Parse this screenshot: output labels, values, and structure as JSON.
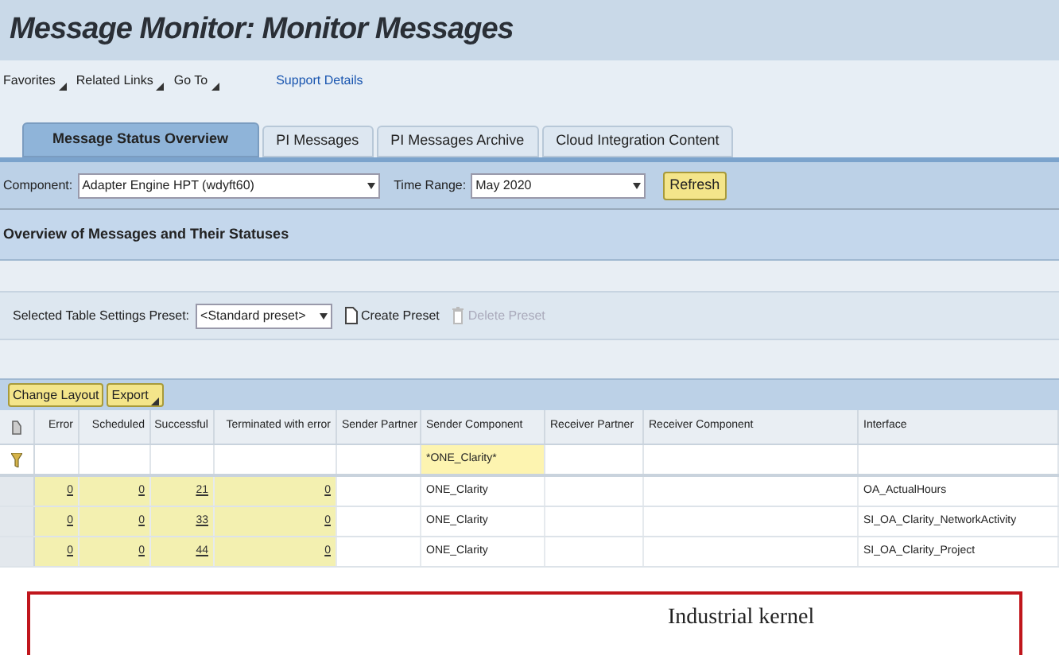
{
  "title": "Message Monitor: Monitor Messages",
  "menu": [
    {
      "label": "Favorites",
      "dropdown": true
    },
    {
      "label": "Related Links",
      "dropdown": true
    },
    {
      "label": "Go To",
      "dropdown": true
    }
  ],
  "support_link": "Support Details",
  "tabs": [
    {
      "label": "Message Status Overview",
      "selected": true
    },
    {
      "label": "PI Messages",
      "selected": false
    },
    {
      "label": "PI Messages Archive",
      "selected": false
    },
    {
      "label": "Cloud Integration Content",
      "selected": false
    }
  ],
  "component": {
    "label": "Component:",
    "value": "Adapter Engine HPT (wdyft60)"
  },
  "time_range": {
    "label": "Time Range:",
    "value": "May 2020"
  },
  "refresh_button": "Refresh",
  "section_title": "Overview of Messages and Their Statuses",
  "preset": {
    "label": "Selected Table Settings Preset:",
    "value": "<Standard preset>",
    "create": {
      "label": "Create Preset",
      "disabled": false
    },
    "delete": {
      "label": "Delete Preset",
      "disabled": true
    }
  },
  "table_buttons": [
    {
      "label": "Change Layout",
      "dropdown": false
    },
    {
      "label": "Export",
      "dropdown": true
    }
  ],
  "table": {
    "columns": [
      "Error",
      "Scheduled",
      "Successful",
      "Terminated with error",
      "Sender Partner",
      "Sender Component",
      "Receiver Partner",
      "Receiver Component",
      "Interface"
    ],
    "filter": {
      "sender_component": "*ONE_Clarity*"
    },
    "rows": [
      {
        "error": "0",
        "scheduled": "0",
        "successful": "21",
        "terminated": "0",
        "sender_component": "ONE_Clarity",
        "interface": "OA_ActualHours"
      },
      {
        "error": "0",
        "scheduled": "0",
        "successful": "33",
        "terminated": "0",
        "sender_component": "ONE_Clarity",
        "interface": "SI_OA_Clarity_NetworkActivity"
      },
      {
        "error": "0",
        "scheduled": "0",
        "successful": "44",
        "terminated": "0",
        "sender_component": "ONE_Clarity",
        "interface": "SI_OA_Clarity_Project"
      }
    ]
  },
  "annotation": {
    "text": "Industrial kernel"
  }
}
